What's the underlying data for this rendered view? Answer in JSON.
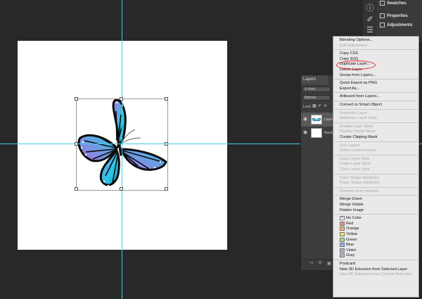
{
  "right_panel": {
    "items": [
      {
        "label": "Swatches",
        "icon": "info-icon"
      },
      {
        "label": "Properties",
        "icon": "brush-icon"
      },
      {
        "label": "Adjustments",
        "icon": "sliders-icon"
      }
    ]
  },
  "layers_panel": {
    "tab": "Layers",
    "filter_value": "Kind",
    "blend_mode": "Normal",
    "lock_label": "Lock:",
    "layers": [
      {
        "name": "Layer",
        "thumb": "butterfly"
      },
      {
        "name": "Backg",
        "thumb": "white"
      }
    ],
    "footer_icons": [
      "link-icon",
      "fx-icon",
      "mask-icon"
    ]
  },
  "context_menu": {
    "items": [
      {
        "label": "Blending Options...",
        "enabled": true
      },
      {
        "label": "Edit Adjustment...",
        "enabled": false
      },
      {
        "label": "Copy CSS",
        "enabled": true,
        "sep_before": true
      },
      {
        "label": "Copy SVG",
        "enabled": true
      },
      {
        "label": "Duplicate Layer...",
        "enabled": true,
        "highlighted": true
      },
      {
        "label": "Delete Layer",
        "enabled": true
      },
      {
        "label": "Group from Layers...",
        "enabled": true
      },
      {
        "label": "Quick Export as PNG",
        "enabled": true,
        "sep_before": true
      },
      {
        "label": "Export As...",
        "enabled": true
      },
      {
        "label": "Artboard from Layers...",
        "enabled": true,
        "sep_before": true
      },
      {
        "label": "Convert to Smart Object",
        "enabled": true,
        "sep_before": true
      },
      {
        "label": "Rasterize Layer",
        "enabled": false,
        "sep_before": true
      },
      {
        "label": "Rasterize Layer Style",
        "enabled": false
      },
      {
        "label": "Enable Layer Mask",
        "enabled": false,
        "sep_before": true
      },
      {
        "label": "Disable Vector Mask",
        "enabled": false
      },
      {
        "label": "Create Clipping Mask",
        "enabled": true
      },
      {
        "label": "Link Layers",
        "enabled": false,
        "sep_before": true
      },
      {
        "label": "Select Linked Layers",
        "enabled": false
      },
      {
        "label": "Copy Layer Style",
        "enabled": false,
        "sep_before": true
      },
      {
        "label": "Paste Layer Style",
        "enabled": false
      },
      {
        "label": "Clear Layer Style",
        "enabled": false
      },
      {
        "label": "Copy Shape Attributes",
        "enabled": false,
        "sep_before": true
      },
      {
        "label": "Paste Shape Attributes",
        "enabled": false
      },
      {
        "label": "Release from Isolation",
        "enabled": false,
        "sep_before": true
      },
      {
        "label": "Merge Down",
        "enabled": true,
        "sep_before": true
      },
      {
        "label": "Merge Visible",
        "enabled": true
      },
      {
        "label": "Flatten Image",
        "enabled": true
      },
      {
        "label": "No Color",
        "enabled": true,
        "sep_before": true,
        "swatch": "#ffffff",
        "swatch_x": true
      },
      {
        "label": "Red",
        "enabled": true,
        "swatch": "#f28b82"
      },
      {
        "label": "Orange",
        "enabled": true,
        "swatch": "#f6b26b"
      },
      {
        "label": "Yellow",
        "enabled": true,
        "swatch": "#ffe066"
      },
      {
        "label": "Green",
        "enabled": true,
        "swatch": "#a8d98a"
      },
      {
        "label": "Blue",
        "enabled": true,
        "swatch": "#8ab4f8"
      },
      {
        "label": "Violet",
        "enabled": true,
        "swatch": "#b4a7d6"
      },
      {
        "label": "Gray",
        "enabled": true,
        "swatch": "#b7b7b7"
      },
      {
        "label": "Postcard",
        "enabled": true,
        "sep_before": true
      },
      {
        "label": "New 3D Extrusion from Selected Layer",
        "enabled": true
      },
      {
        "label": "New 3D Extrusion from Current Selection",
        "enabled": false
      }
    ]
  },
  "colors": {
    "guide": "#3fd0e6",
    "highlight_ring": "#e3242b",
    "butterfly_primary": "#2fc7e8",
    "butterfly_secondary": "#b06fe0"
  }
}
